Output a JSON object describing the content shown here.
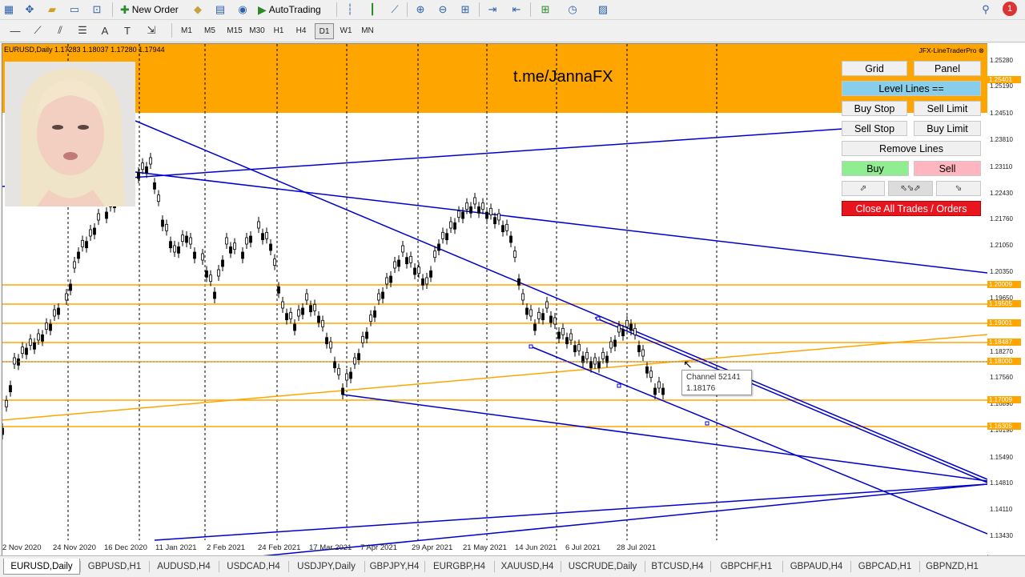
{
  "toolbar": {
    "new_order_label": "New Order",
    "autotrading_label": "AutoTrading",
    "notification_count": "1",
    "icons": [
      "new-chart-icon",
      "profiles-icon",
      "open-folder-icon",
      "market-watch-icon",
      "data-window-icon",
      "navigator-icon",
      "metaeditor-icon",
      "signals-icon",
      "bar-chart-icon",
      "candlestick-icon",
      "line-chart-icon",
      "zoom-in-icon",
      "zoom-out-icon",
      "tile-windows-icon",
      "chart-shift-icon",
      "autoscroll-icon",
      "indicators-icon",
      "periods-icon",
      "templates-icon",
      "search-icon"
    ]
  },
  "timeframes": [
    "M1",
    "M5",
    "M15",
    "M30",
    "H1",
    "H4",
    "D1",
    "W1",
    "MN"
  ],
  "active_timeframe": "D1",
  "chart": {
    "symbol_info": "EURUSD,Daily  1.17283 1.18037 1.17280 1.17944",
    "brand_text": "t.me/JannaFX",
    "panel_title": "JFX-LineTraderPro",
    "price_labels": [
      "1.25280",
      "1.25190",
      "1.24510",
      "1.23810",
      "1.23110",
      "1.22430",
      "1.21760",
      "1.21050",
      "1.20350",
      "1.19650",
      "1.18960",
      "1.18270",
      "1.17560",
      "1.16890",
      "1.16190",
      "1.15490",
      "1.14810",
      "1.14110",
      "1.13430"
    ],
    "level_boxes": [
      "1.25401",
      "1.20009",
      "1.19505",
      "1.19001",
      "1.18487",
      "1.18000",
      "1.17009",
      "1.16305"
    ],
    "date_labels": [
      "2 Nov 2020",
      "24 Nov 2020",
      "16 Dec 2020",
      "11 Jan 2021",
      "2 Feb 2021",
      "24 Feb 2021",
      "17 Mar 2021",
      "7 Apr 2021",
      "29 Apr 2021",
      "21 May 2021",
      "14 Jun 2021",
      "6 Jul 2021",
      "28 Jul 2021"
    ],
    "tooltip": {
      "name": "Channel 52141",
      "value": "1.18176"
    },
    "colors": {
      "level_line": "#ffa500",
      "trend_line": "#0000cd",
      "header_band": "#ffa500",
      "candle": "#000000"
    }
  },
  "panel": {
    "grid": "Grid",
    "panel": "Panel",
    "level_lines": "Level Lines ==",
    "buy_stop": "Buy Stop",
    "sell_limit": "Sell Limit",
    "sell_stop": "Sell Stop",
    "buy_limit": "Buy Limit",
    "remove_lines": "Remove Lines",
    "buy": "Buy",
    "sell": "Sell",
    "close_all": "Close All Trades / Orders"
  },
  "tabs": [
    "EURUSD,Daily",
    "GBPUSD,H1",
    "AUDUSD,H4",
    "USDCAD,H4",
    "USDJPY,Daily",
    "GBPJPY,H4",
    "EURGBP,H4",
    "XAUUSD,H4",
    "USCRUDE,Daily",
    "BTCUSD,H4",
    "GBPCHF,H1",
    "GBPAUD,H4",
    "GBPCAD,H1",
    "GBPNZD,H1"
  ],
  "active_tab": "EURUSD,Daily"
}
